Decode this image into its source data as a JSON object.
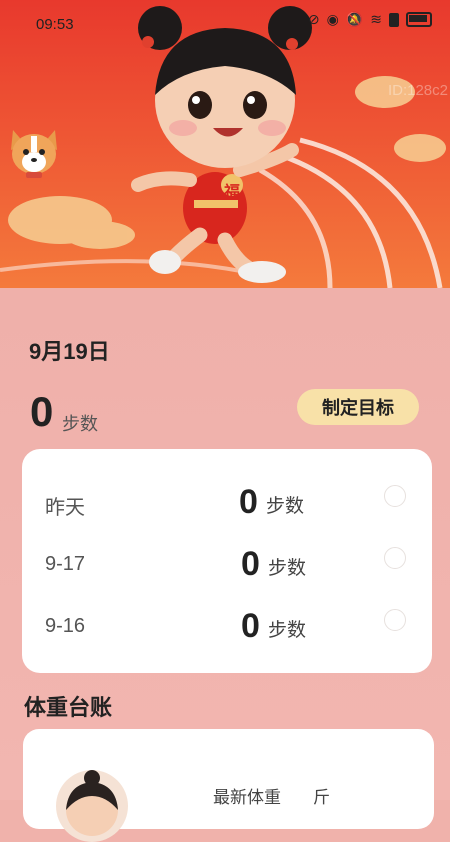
{
  "status_bar": {
    "time": "09:53"
  },
  "watermark": "ID:128c2",
  "today": {
    "date": "9月19日",
    "steps": "0",
    "steps_unit": "步数"
  },
  "goal_button": "制定目标",
  "history": [
    {
      "label": "昨天",
      "steps": "0",
      "unit": "步数"
    },
    {
      "label": "9-17",
      "steps": "0",
      "unit": "步数"
    },
    {
      "label": "9-16",
      "steps": "0",
      "unit": "步数"
    }
  ],
  "weight": {
    "title": "体重台账",
    "latest_label": "最新体重",
    "unit": "斤"
  },
  "hero_badge": "福"
}
